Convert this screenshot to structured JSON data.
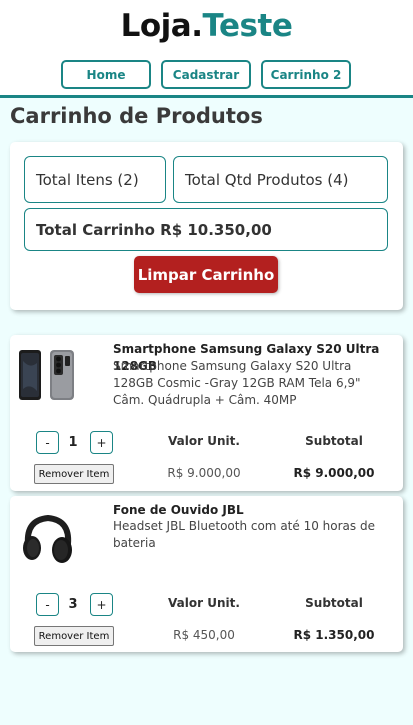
{
  "header": {
    "logo_part1": "Loja.",
    "logo_part2": "Teste",
    "nav": [
      "Home",
      "Cadastrar",
      "Carrinho 2"
    ]
  },
  "page": {
    "title": "Carrinho de Produtos"
  },
  "summary": {
    "total_items": "Total Itens (2)",
    "total_qty": "Total Qtd Produtos (4)",
    "total_cart": "Total Carrinho R$ 10.350,00",
    "clear_label": "Limpar Carrinho"
  },
  "items": [
    {
      "name": "Smartphone Samsung Galaxy S20 Ultra 128GB",
      "description": "Smartphone Samsung Galaxy S20 Ultra 128GB Cosmic -Gray 12GB RAM Tela 6,9\" Câm. Quádrupla + Câm. 40MP",
      "qty": "1",
      "unit_label": "Valor Unit.",
      "unit_price": "R$ 9.000,00",
      "subtotal_label": "Subtotal",
      "subtotal": "R$ 9.000,00",
      "minus": "-",
      "plus": "+",
      "remove_label": "Remover Item",
      "image": "smartphone-image"
    },
    {
      "name": "Fone de Ouvido JBL",
      "description": "Headset JBL Bluetooth com até 10 horas de bateria",
      "qty": "3",
      "unit_label": "Valor Unit.",
      "unit_price": "R$ 450,00",
      "subtotal_label": "Subtotal",
      "subtotal": "R$ 1.350,00",
      "minus": "-",
      "plus": "+",
      "remove_label": "Remover Item",
      "image": "headphones-image"
    }
  ],
  "colors": {
    "accent": "#1a8585",
    "danger": "#b3201f",
    "background": "#eefefe"
  }
}
